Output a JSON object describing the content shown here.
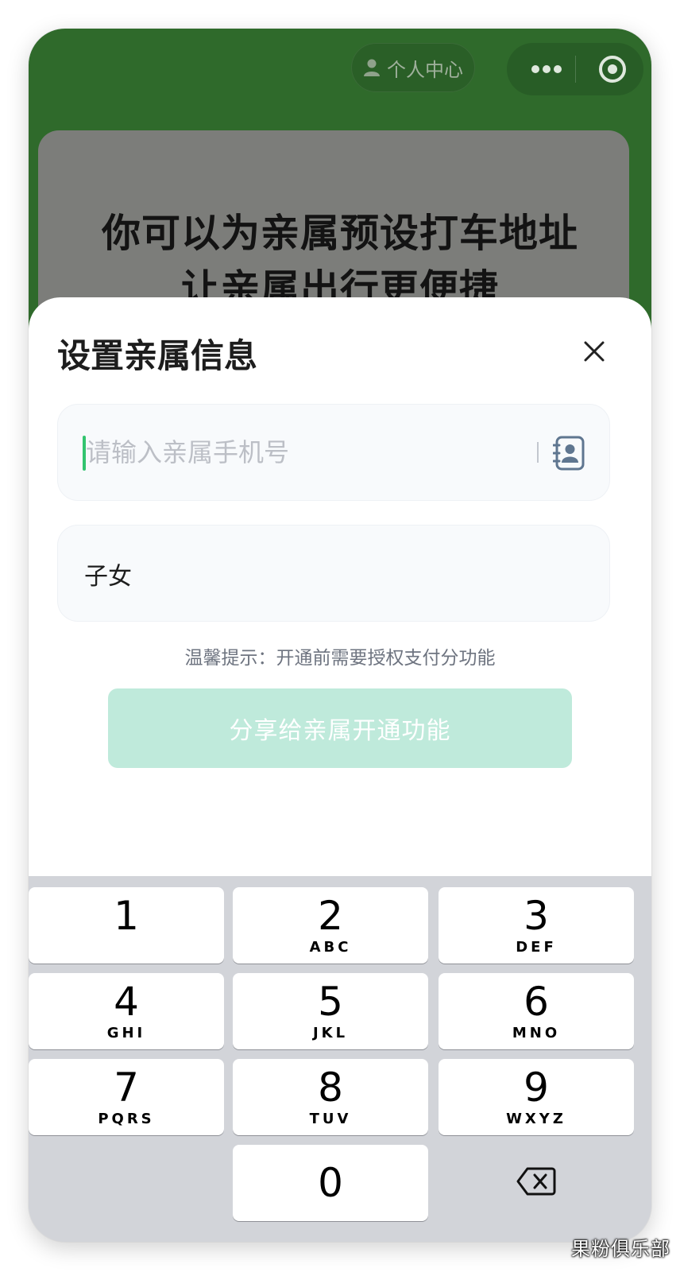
{
  "header": {
    "personal_center": "个人中心",
    "more_icon": "more-dots-icon",
    "close_icon": "target-close-icon"
  },
  "banner": {
    "line1": "你可以为亲属预设打车地址",
    "line2": "让亲属出行更便捷"
  },
  "sheet": {
    "title": "设置亲属信息",
    "phone_placeholder": "请输入亲属手机号",
    "phone_value": "",
    "relation": "子女",
    "tip": "温馨提示：开通前需要授权支付分功能",
    "share_button": "分享给亲属开通功能"
  },
  "keypad": {
    "keys": [
      {
        "digit": "1",
        "letters": ""
      },
      {
        "digit": "2",
        "letters": "ABC"
      },
      {
        "digit": "3",
        "letters": "DEF"
      },
      {
        "digit": "4",
        "letters": "GHI"
      },
      {
        "digit": "5",
        "letters": "JKL"
      },
      {
        "digit": "6",
        "letters": "MNO"
      },
      {
        "digit": "7",
        "letters": "PQRS"
      },
      {
        "digit": "8",
        "letters": "TUV"
      },
      {
        "digit": "9",
        "letters": "WXYZ"
      },
      {
        "digit": "0",
        "letters": ""
      }
    ],
    "backspace_icon": "backspace-icon"
  },
  "watermark": "果粉俱乐部",
  "colors": {
    "header_green": "#2f6a2b",
    "accent_green": "#33c46f",
    "button_disabled": "#bfeadb",
    "keypad_bg": "#d2d4d9"
  }
}
